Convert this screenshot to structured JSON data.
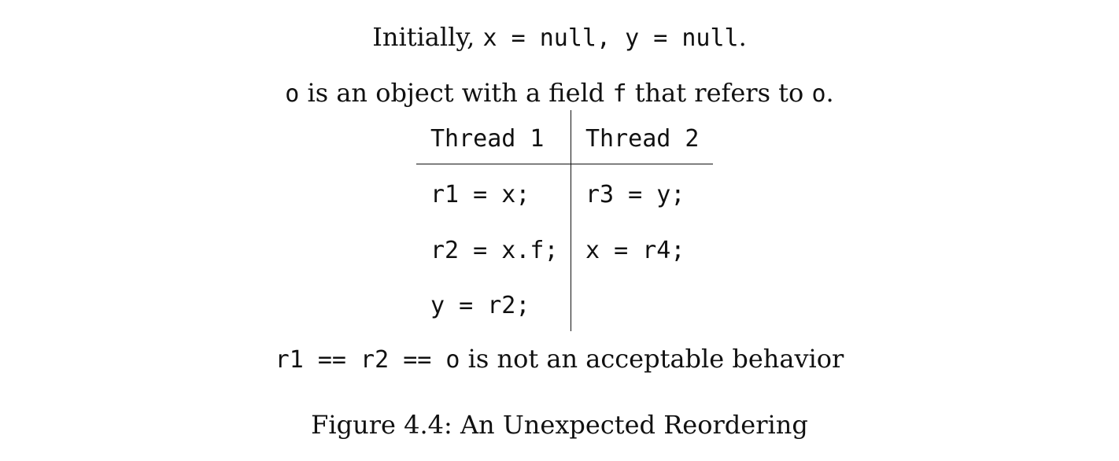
{
  "initial_line": {
    "prefix": "Initially, ",
    "code": "x = null, y = null",
    "suffix": "."
  },
  "object_line": {
    "code_o": "o",
    "text_1": " is an object with a field ",
    "code_f": "f",
    "text_2": " that refers to ",
    "code_o2": "o",
    "suffix": "."
  },
  "table": {
    "headers": [
      "Thread 1",
      "Thread 2"
    ],
    "thread1": [
      "r1 = x;",
      "r2 = x.f;",
      "y = r2;"
    ],
    "thread2": [
      "r3 = y;",
      "x = r4;"
    ]
  },
  "result_line": {
    "code": "r1 == r2 == o",
    "text": " is not an acceptable behavior"
  },
  "caption": "Figure 4.4: An Unexpected Reordering"
}
